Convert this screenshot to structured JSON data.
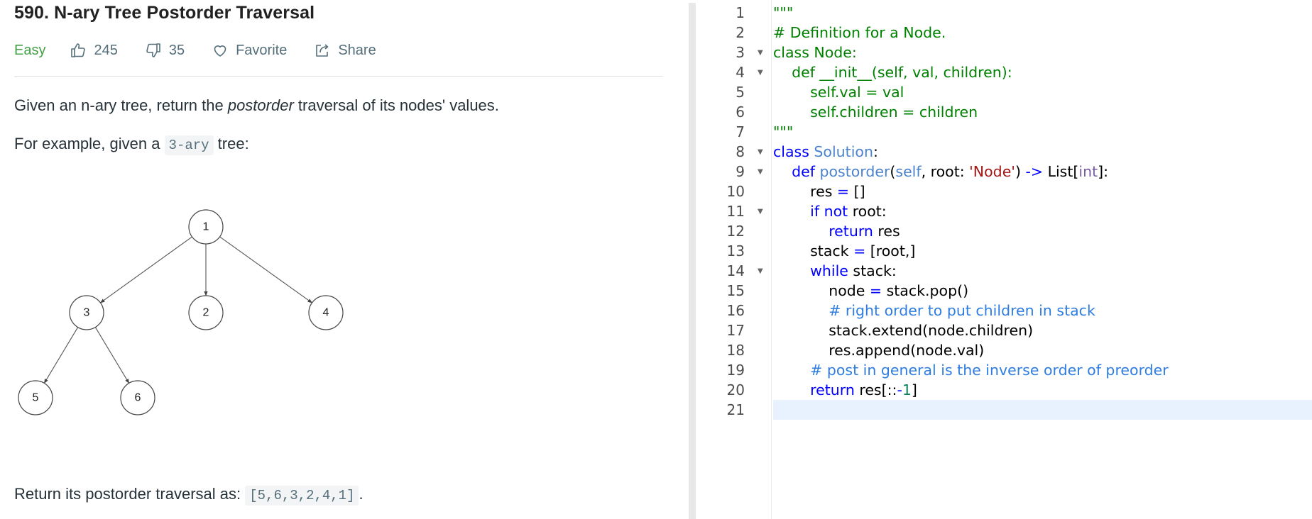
{
  "problem": {
    "title": "590. N-ary Tree Postorder Traversal",
    "difficulty": "Easy",
    "likes": "245",
    "dislikes": "35",
    "favorite_label": "Favorite",
    "share_label": "Share",
    "para1": {
      "before": "Given an n-ary tree, return the ",
      "emphasis": "postorder",
      "after": " traversal of its nodes' values."
    },
    "para2": {
      "before": "For example, given a ",
      "code": "3-ary",
      "after": " tree:"
    },
    "tree_nodes": [
      {
        "id": "1",
        "label": "1"
      },
      {
        "id": "3",
        "label": "3"
      },
      {
        "id": "2",
        "label": "2"
      },
      {
        "id": "4",
        "label": "4"
      },
      {
        "id": "5",
        "label": "5"
      },
      {
        "id": "6",
        "label": "6"
      }
    ],
    "tree_edges": [
      [
        "1",
        "3"
      ],
      [
        "1",
        "2"
      ],
      [
        "1",
        "4"
      ],
      [
        "3",
        "5"
      ],
      [
        "3",
        "6"
      ]
    ],
    "para3": {
      "before": "Return its postorder traversal as: ",
      "code": "[5,6,3,2,4,1]",
      "after": "."
    }
  },
  "editor": {
    "active_line": 21,
    "lines": [
      {
        "n": "1",
        "fold": false,
        "tokens": [
          [
            "doc",
            "\"\"\""
          ]
        ]
      },
      {
        "n": "2",
        "fold": false,
        "tokens": [
          [
            "doc",
            "# Definition for a Node."
          ]
        ]
      },
      {
        "n": "3",
        "fold": true,
        "tokens": [
          [
            "doc",
            "class Node:"
          ]
        ]
      },
      {
        "n": "4",
        "fold": true,
        "tokens": [
          [
            "doc",
            "    def __init__(self, val, children):"
          ]
        ]
      },
      {
        "n": "5",
        "fold": false,
        "tokens": [
          [
            "doc",
            "        self.val = val"
          ]
        ]
      },
      {
        "n": "6",
        "fold": false,
        "tokens": [
          [
            "doc",
            "        self.children = children"
          ]
        ]
      },
      {
        "n": "7",
        "fold": false,
        "tokens": [
          [
            "doc",
            "\"\"\""
          ]
        ]
      },
      {
        "n": "8",
        "fold": true,
        "tokens": [
          [
            "kw",
            "class"
          ],
          [
            "plain",
            " "
          ],
          [
            "self",
            "Solution"
          ],
          [
            "plain",
            ":"
          ]
        ]
      },
      {
        "n": "9",
        "fold": true,
        "tokens": [
          [
            "plain",
            "    "
          ],
          [
            "kw",
            "def"
          ],
          [
            "plain",
            " "
          ],
          [
            "self",
            "postorder"
          ],
          [
            "plain",
            "("
          ],
          [
            "self",
            "self"
          ],
          [
            "plain",
            ", root: "
          ],
          [
            "str",
            "'Node'"
          ],
          [
            "plain",
            ") "
          ],
          [
            "op",
            "->"
          ],
          [
            "plain",
            " List["
          ],
          [
            "bt",
            "int"
          ],
          [
            "plain",
            "]:"
          ]
        ]
      },
      {
        "n": "10",
        "fold": false,
        "tokens": [
          [
            "plain",
            "        res "
          ],
          [
            "op",
            "="
          ],
          [
            "plain",
            " []"
          ]
        ]
      },
      {
        "n": "11",
        "fold": true,
        "tokens": [
          [
            "plain",
            "        "
          ],
          [
            "kw",
            "if"
          ],
          [
            "plain",
            " "
          ],
          [
            "kw",
            "not"
          ],
          [
            "plain",
            " root:"
          ]
        ]
      },
      {
        "n": "12",
        "fold": false,
        "tokens": [
          [
            "plain",
            "            "
          ],
          [
            "kw",
            "return"
          ],
          [
            "plain",
            " res"
          ]
        ]
      },
      {
        "n": "13",
        "fold": false,
        "tokens": [
          [
            "plain",
            "        stack "
          ],
          [
            "op",
            "="
          ],
          [
            "plain",
            " [root,]"
          ]
        ]
      },
      {
        "n": "14",
        "fold": true,
        "tokens": [
          [
            "plain",
            "        "
          ],
          [
            "kw",
            "while"
          ],
          [
            "plain",
            " stack:"
          ]
        ]
      },
      {
        "n": "15",
        "fold": false,
        "tokens": [
          [
            "plain",
            "            node "
          ],
          [
            "op",
            "="
          ],
          [
            "plain",
            " stack.pop()"
          ]
        ]
      },
      {
        "n": "16",
        "fold": false,
        "tokens": [
          [
            "plain",
            "            "
          ],
          [
            "cmt",
            "# right order to put children in stack"
          ]
        ]
      },
      {
        "n": "17",
        "fold": false,
        "tokens": [
          [
            "plain",
            "            stack.extend(node.children)"
          ]
        ]
      },
      {
        "n": "18",
        "fold": false,
        "tokens": [
          [
            "plain",
            "            res.append(node.val)"
          ]
        ]
      },
      {
        "n": "19",
        "fold": false,
        "tokens": [
          [
            "plain",
            "        "
          ],
          [
            "cmt",
            "# post in general is the inverse order of preorder"
          ]
        ]
      },
      {
        "n": "20",
        "fold": false,
        "tokens": [
          [
            "plain",
            "        "
          ],
          [
            "kw",
            "return"
          ],
          [
            "plain",
            " res[::"
          ],
          [
            "op",
            "-"
          ],
          [
            "num",
            "1"
          ],
          [
            "plain",
            "]"
          ]
        ]
      },
      {
        "n": "21",
        "fold": false,
        "tokens": []
      }
    ]
  }
}
